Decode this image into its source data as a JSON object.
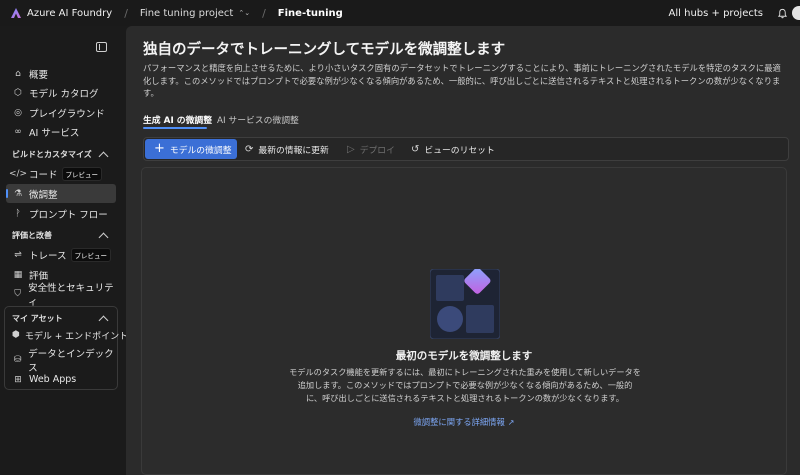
{
  "topbar": {
    "brand": "Azure AI Foundry",
    "project": "Fine tuning project",
    "page": "Fine-tuning",
    "hubs": "All hubs + projects"
  },
  "sidebar": {
    "items_top": [
      {
        "label": "概要",
        "icon": "overview-icon"
      },
      {
        "label": "モデル カタログ",
        "icon": "catalog-icon"
      },
      {
        "label": "プレイグラウンド",
        "icon": "playground-icon"
      },
      {
        "label": "AI サービス",
        "icon": "ai-services-icon"
      }
    ],
    "section_build": "ビルドとカスタマイズ",
    "items_build": [
      {
        "label": "コード",
        "badge": "プレビュー",
        "icon": "code-icon"
      },
      {
        "label": "微調整",
        "icon": "finetune-icon"
      },
      {
        "label": "プロンプト フロー",
        "icon": "prompt-flow-icon"
      }
    ],
    "section_eval": "評価と改善",
    "items_eval": [
      {
        "label": "トレース",
        "badge": "プレビュー",
        "icon": "trace-icon"
      },
      {
        "label": "評価",
        "icon": "evaluation-icon"
      },
      {
        "label": "安全性とセキュリティ",
        "icon": "shield-icon"
      }
    ],
    "section_assets": "マイ アセット",
    "items_assets": [
      {
        "label": "モデル + エンドポイント",
        "icon": "models-icon"
      },
      {
        "label": "データとインデックス",
        "icon": "data-icon"
      },
      {
        "label": "Web Apps",
        "icon": "webapps-icon"
      }
    ]
  },
  "main": {
    "title": "独自のデータでトレーニングしてモデルを微調整します",
    "description": "パフォーマンスと精度を向上させるために、より小さいタスク固有のデータセットでトレーニングすることにより、事前にトレーニングされたモデルを特定のタスクに最適化します。このメソッドではプロンプトで必要な例が少なくなる傾向があるため、一般的に、呼び出しごとに送信されるテキストと処理されるトークンの数が少なくなります。",
    "tabs": [
      "生成 AI の微調整",
      "AI サービスの微調整"
    ],
    "toolbar": {
      "primary": "モデルの微調整",
      "refresh": "最新の情報に更新",
      "deploy": "デプロイ",
      "reset": "ビューのリセット"
    },
    "empty": {
      "title": "最初のモデルを微調整します",
      "desc_1": "モデルのタスク機能を更新するには、最初にトレーニングされた重みを使用して新しいデータを",
      "desc_2": "追加します。このメソッドではプロンプトで必要な例が少なくなる傾向があるため、一般的",
      "desc_3": "に、呼び出しごとに送信されるテキストと処理されるトークンの数が少なくなります。",
      "link": "微調整に関する詳細情報"
    }
  },
  "colors": {
    "accent": "#3b6fd6",
    "link": "#7da7f5",
    "background": "#1b1b1b",
    "panel": "#2b2b2b"
  }
}
